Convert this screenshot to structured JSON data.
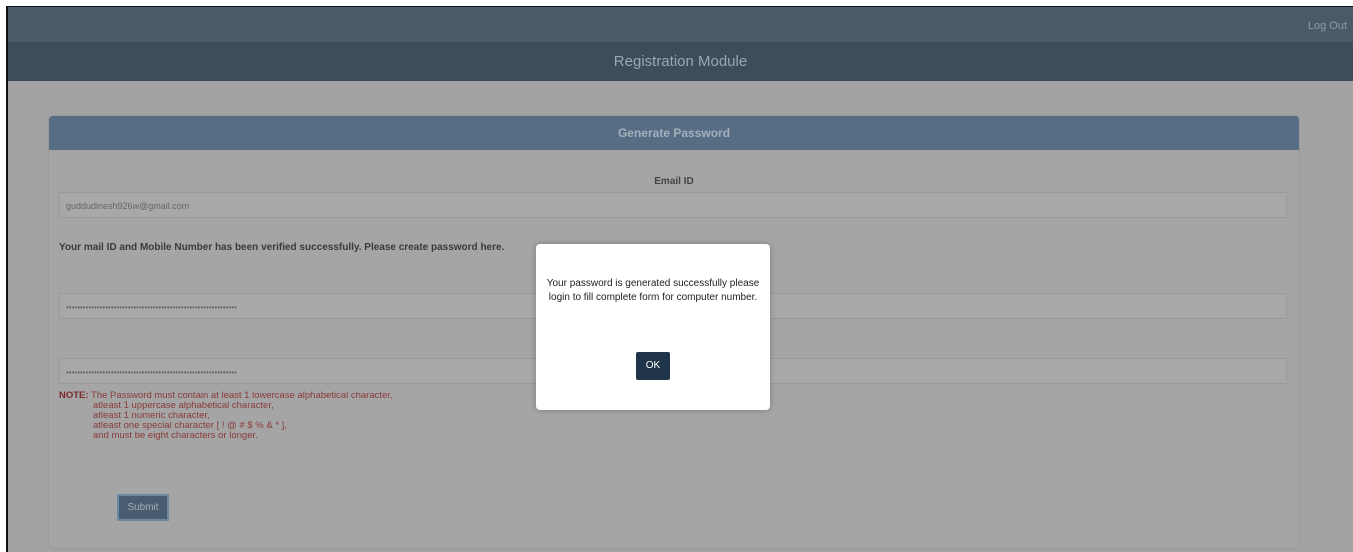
{
  "header": {
    "logout_label": "Log Out",
    "module_title": "Registration Module"
  },
  "card": {
    "title": "Generate Password",
    "email_label": "Email ID",
    "email_value": "guddudinesh926w@gmail.com",
    "verified_message": "Your mail ID and Mobile Number has been verified successfully. Please create password here.",
    "password_mask": "•••••••••••••••••••••••••••••••••••••••••••••••••••••••••••••",
    "confirm_password_mask": "•••••••••••••••••••••••••••••••••••••••••••••••••••••••••••••",
    "note": {
      "label": "NOTE:",
      "line1": "The Password must contain at least 1 lowercase alphabetical character,",
      "line2": "atleast 1 uppercase alphabetical character,",
      "line3": "atleast 1 numeric character,",
      "line4": "atleast one special character [ ! @ # $ % & * ],",
      "line5": "and must be eight characters or longer."
    },
    "submit_label": "Submit"
  },
  "modal": {
    "message": "Your password is generated successfully please login to fill complete form for computer number.",
    "ok_label": "OK"
  }
}
